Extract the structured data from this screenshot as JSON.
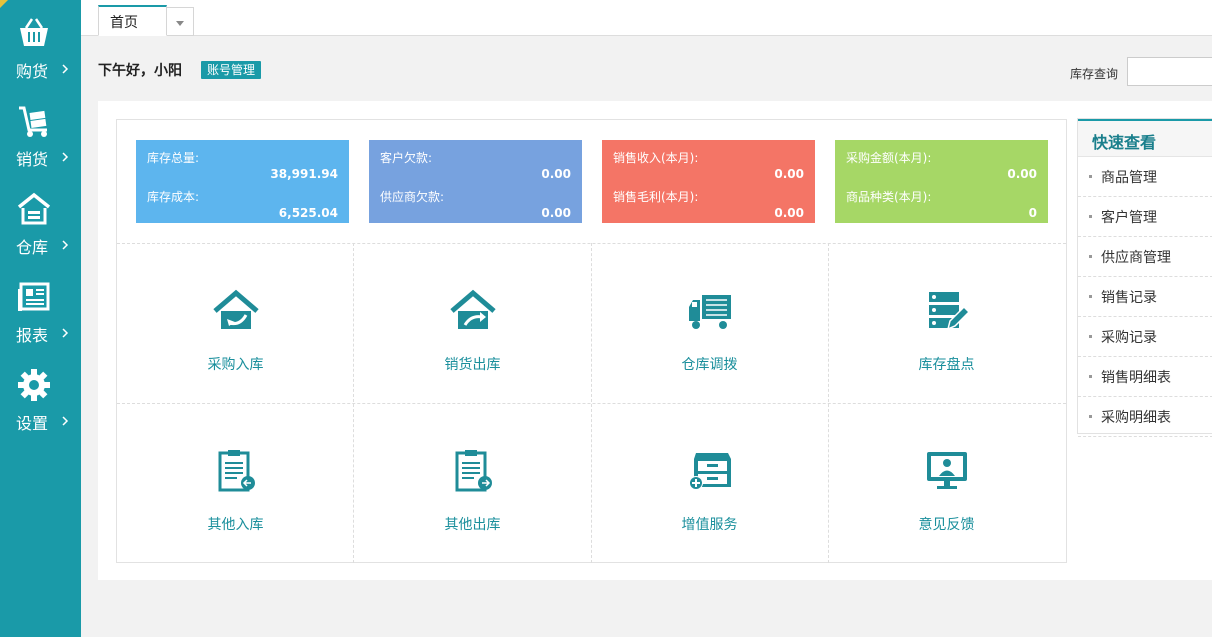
{
  "sidebar": {
    "items": [
      {
        "label": "购货",
        "icon": "basket-icon"
      },
      {
        "label": "销货",
        "icon": "hand-truck-icon"
      },
      {
        "label": "仓库",
        "icon": "warehouse-icon"
      },
      {
        "label": "报表",
        "icon": "report-icon"
      },
      {
        "label": "设置",
        "icon": "gear-icon"
      }
    ]
  },
  "tabs": {
    "home": "首页"
  },
  "header": {
    "greeting": "下午好，小阳",
    "account_button": "账号管理",
    "search_label": "库存查询",
    "search_value": ""
  },
  "stats": [
    {
      "color": "#5db5ee",
      "rows": [
        {
          "label": "库存总量:",
          "value": "38,991.94"
        },
        {
          "label": "库存成本:",
          "value": "6,525.04"
        }
      ]
    },
    {
      "color": "#77a2df",
      "rows": [
        {
          "label": "客户欠款:",
          "value": "0.00"
        },
        {
          "label": "供应商欠款:",
          "value": "0.00"
        }
      ]
    },
    {
      "color": "#f47566",
      "rows": [
        {
          "label": "销售收入(本月):",
          "value": "0.00"
        },
        {
          "label": "销售毛利(本月):",
          "value": "0.00"
        }
      ]
    },
    {
      "color": "#a6d766",
      "rows": [
        {
          "label": "采购金额(本月):",
          "value": "0.00"
        },
        {
          "label": "商品种类(本月):",
          "value": "0"
        }
      ]
    }
  ],
  "tiles": [
    {
      "label": "采购入库",
      "icon": "house-inbound-icon"
    },
    {
      "label": "销货出库",
      "icon": "house-outbound-icon"
    },
    {
      "label": "仓库调拨",
      "icon": "truck-icon"
    },
    {
      "label": "库存盘点",
      "icon": "server-edit-icon"
    },
    {
      "label": "其他入库",
      "icon": "clipboard-in-icon"
    },
    {
      "label": "其他出库",
      "icon": "clipboard-out-icon"
    },
    {
      "label": "增值服务",
      "icon": "cabinet-plus-icon"
    },
    {
      "label": "意见反馈",
      "icon": "monitor-user-icon"
    }
  ],
  "quick_view": {
    "title": "快速查看",
    "items": [
      "商品管理",
      "客户管理",
      "供应商管理",
      "销售记录",
      "采购记录",
      "销售明细表",
      "采购明细表"
    ]
  },
  "colors": {
    "accent": "#1a9aa8",
    "tile_text": "#1a8f9c",
    "icon": "#1f8c98"
  }
}
